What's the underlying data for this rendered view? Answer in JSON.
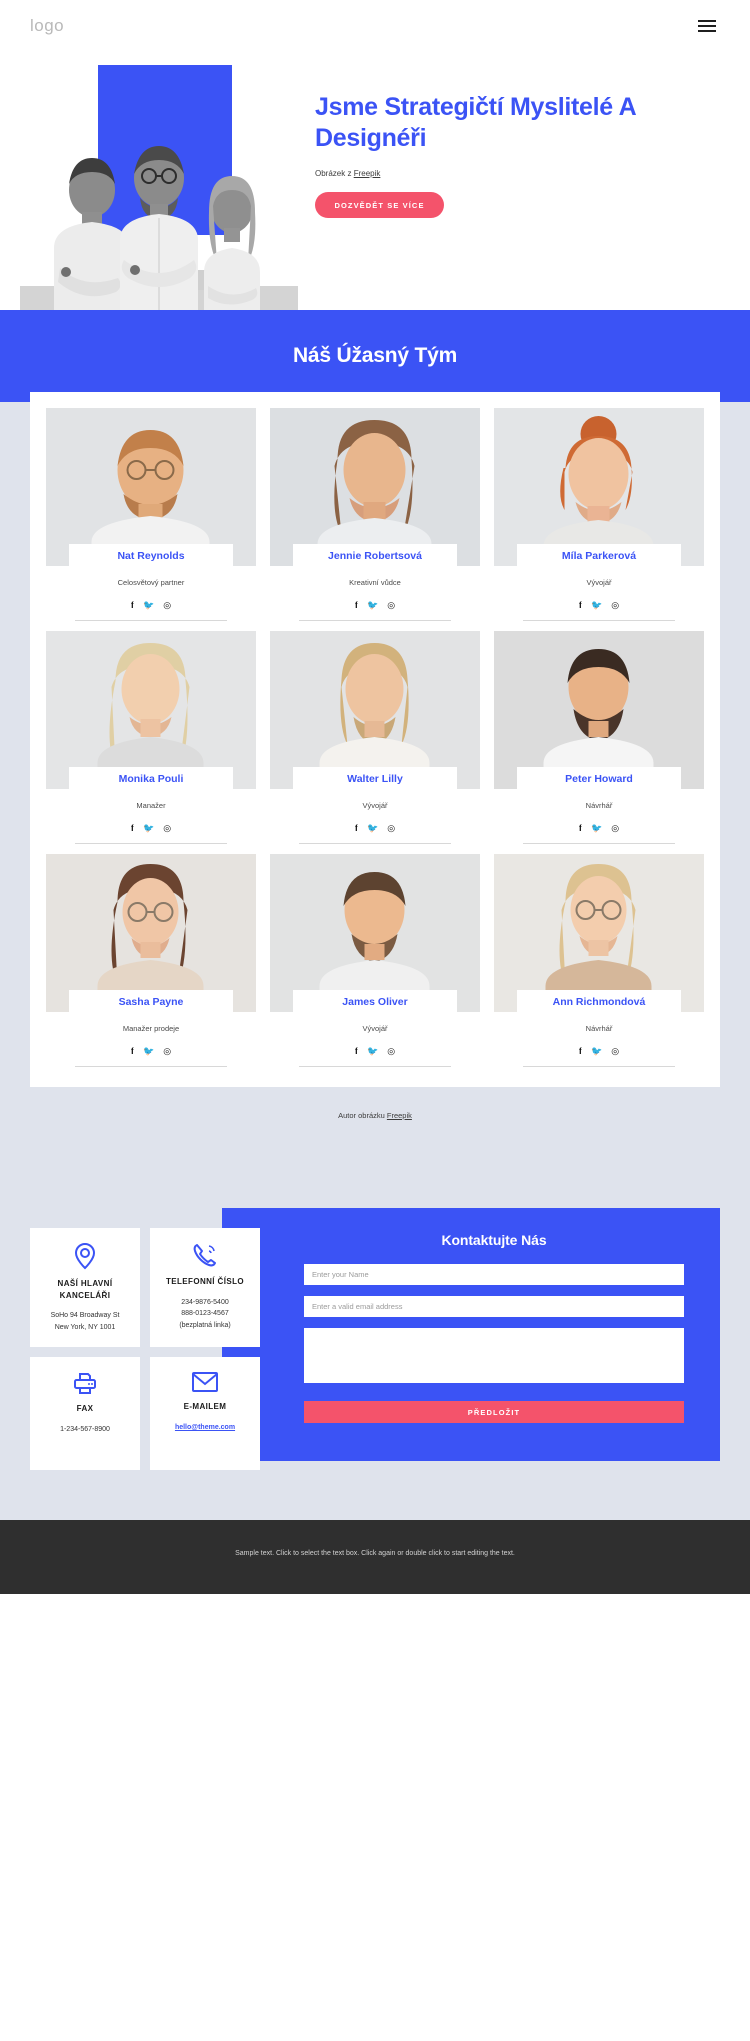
{
  "header": {
    "logo": "logo",
    "menu_icon": "hamburger-menu-icon"
  },
  "hero": {
    "title": "Jsme Strategičtí Myslitelé A Designéři",
    "credit_prefix": "Obrázek z ",
    "credit_link": "Freepik",
    "cta_label": "DOZVĚDĚT SE VÍCE",
    "accent_color": "#3b53f5",
    "cta_color": "#f4536b"
  },
  "team": {
    "heading": "Náš Úžasný Tým",
    "credit_prefix": "Autor obrázku ",
    "credit_link": "Freepik",
    "social": [
      "facebook-icon",
      "twitter-icon",
      "instagram-icon"
    ],
    "members": [
      {
        "name": "Nat Reynolds",
        "role": "Celosvětový partner"
      },
      {
        "name": "Jennie Robertsová",
        "role": "Kreativní vůdce"
      },
      {
        "name": "Míla Parkerová",
        "role": "Vývojář"
      },
      {
        "name": "Monika Pouli",
        "role": "Manažer"
      },
      {
        "name": "Walter Lilly",
        "role": "Vývojář"
      },
      {
        "name": "Peter Howard",
        "role": "Návrhář"
      },
      {
        "name": "Sasha Payne",
        "role": "Manažer prodeje"
      },
      {
        "name": "James Oliver",
        "role": "Vývojář"
      },
      {
        "name": "Ann Richmondová",
        "role": "Návrhář"
      }
    ]
  },
  "contact": {
    "cards": [
      {
        "icon": "location-pin-icon",
        "title": "NAŠÍ HLAVNÍ KANCELÁŘI",
        "lines": [
          "SoHo 94 Broadway St",
          "New York, NY 1001"
        ]
      },
      {
        "icon": "phone-icon",
        "title": "TELEFONNÍ ČÍSLO",
        "lines": [
          "234-9876-5400",
          "888-0123-4567",
          "(bezplatná linka)"
        ]
      },
      {
        "icon": "fax-printer-icon",
        "title": "FAX",
        "lines": [
          "1-234-567-8900"
        ]
      },
      {
        "icon": "envelope-icon",
        "title": "E-MAILEM",
        "lines": [
          "hello@theme.com"
        ],
        "is_link": true
      }
    ],
    "form": {
      "title": "Kontaktujte Nás",
      "name_placeholder": "Enter your Name",
      "email_placeholder": "Enter a valid email address",
      "message_placeholder": "",
      "submit_label": "PŘEDLOŽIT"
    }
  },
  "footer": {
    "text": "Sample text. Click to select the text box. Click again or double click to start editing the text."
  }
}
